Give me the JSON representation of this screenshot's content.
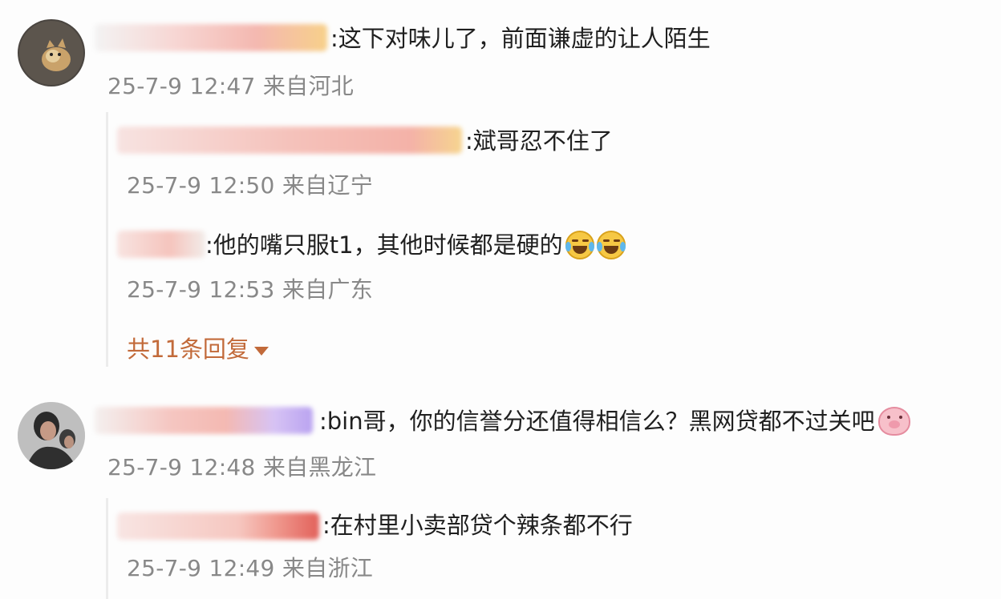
{
  "comments": [
    {
      "avatar": "cat-avatar",
      "text": ":这下对味儿了，前面谦虚的让人陌生",
      "meta": "25-7-9 12:47 来自河北",
      "replies": [
        {
          "text": ":斌哥忍不住了",
          "meta": "25-7-9 12:50 来自辽宁",
          "emoji": ""
        },
        {
          "text": ":他的嘴只服t1，其他时候都是硬的",
          "meta": "25-7-9 12:53 来自广东",
          "emoji": "laugh-cry-icon x2"
        }
      ],
      "more_replies": "共11条回复"
    },
    {
      "avatar": "person-avatar",
      "text": ":bin哥，你的信誉分还值得相信么？黑网贷都不过关吧",
      "emoji": "pig-icon",
      "meta": "25-7-9 12:48 来自黑龙江",
      "replies": [
        {
          "text": ":在村里小卖部贷个辣条都不行",
          "meta": "25-7-9 12:49 来自浙江"
        }
      ]
    }
  ],
  "colors": {
    "meta_gray": "#888888",
    "more_replies": "#c26a3a",
    "background": "#fdfdfd"
  }
}
